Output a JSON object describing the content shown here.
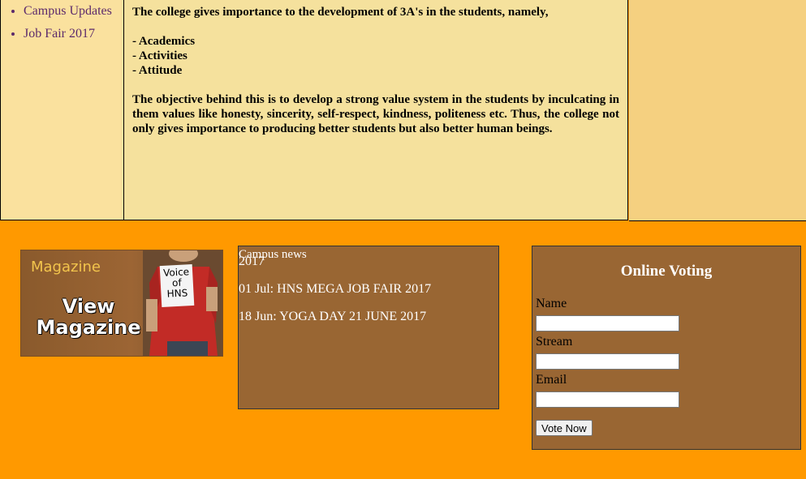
{
  "sidebar": {
    "items": [
      {
        "label": "Campus Updates"
      },
      {
        "label": "Job Fair 2017"
      }
    ]
  },
  "content": {
    "intro": "The college gives importance to the development of 3A's in the students, namely,",
    "list": [
      "- Academics",
      "- Activities",
      "- Attitude"
    ],
    "objective": "The objective behind this is to develop a strong value system in the students by inculcating in them values like honesty, sincerity, self-respect, kindness, politeness etc. Thus, the college not only gives importance to producing better students but also better human beings."
  },
  "magazine": {
    "label": "Magazine",
    "view_line1": "View",
    "view_line2": "Magazine",
    "tag_text": [
      "Voice",
      "of",
      "HNS"
    ]
  },
  "news": {
    "title": "Campus news",
    "items": [
      "2017",
      "01 Jul: HNS MEGA JOB FAIR 2017",
      "18 Jun: YOGA DAY 21 JUNE 2017"
    ]
  },
  "voting": {
    "title": "Online Voting",
    "fields": [
      {
        "label": "Name",
        "value": ""
      },
      {
        "label": "Stream",
        "value": ""
      },
      {
        "label": "Email",
        "value": ""
      }
    ],
    "button_label": "Vote Now"
  },
  "colors": {
    "footer_bg": "#ff9900",
    "panel_bg": "#996633",
    "content_bg": "#f5e19d",
    "link": "#5c2a6b"
  }
}
